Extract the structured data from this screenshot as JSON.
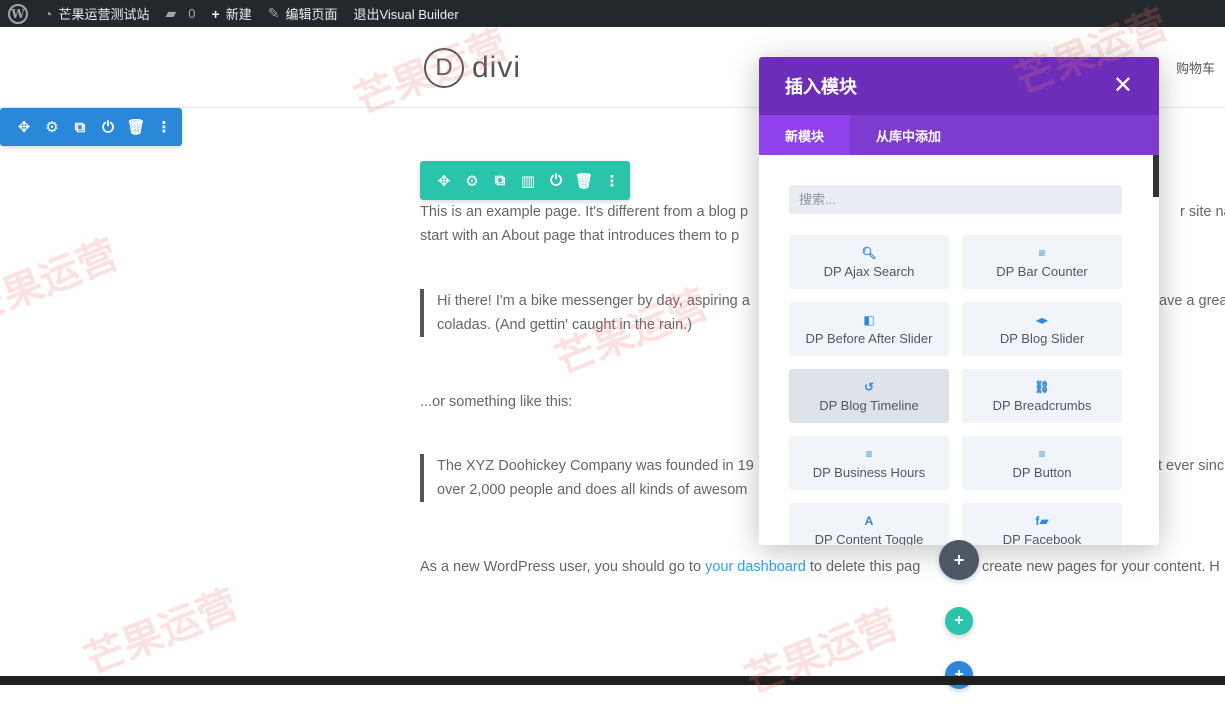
{
  "adminbar": {
    "site_name": "芒果运营测试站",
    "comments_count": "0",
    "new_label": "新建",
    "edit_label": "编辑页面",
    "exit_label": "退出Visual Builder"
  },
  "header": {
    "logo_letter": "D",
    "logo_word": "divi",
    "cart_label": "购物车"
  },
  "content": {
    "p1_line1": "This is an example page. It's different from a blog p",
    "p1_line1_right": "r site navi",
    "p1_line2": "start with an About page that introduces them to p",
    "q1_line1": "Hi there! I'm a bike messenger by day, aspiring a",
    "q1_line1_right": "ave a grea",
    "q1_line2": "coladas. (And gettin' caught in the rain.)",
    "p2": "...or something like this:",
    "q2_line1": "The XYZ Doohickey Company was founded in 19",
    "q2_line1_right": "t ever sinc",
    "q2_line2": "over 2,000 people and does all kinds of awesom",
    "p3_before": "As a new WordPress user, you should go to ",
    "p3_link": "your dashboard",
    "p3_after": " to delete this pag",
    "p3_right": "create new pages for your content. H"
  },
  "modal": {
    "title": "插入模块",
    "close": "✕",
    "tabs": [
      "新模块",
      "从库中添加"
    ],
    "search_placeholder": "搜索...",
    "modules": [
      {
        "label": "DP Ajax Search",
        "icon": "🔍︎"
      },
      {
        "label": "DP Bar Counter",
        "icon": "≡"
      },
      {
        "label": "DP Before After Slider",
        "icon": "◧"
      },
      {
        "label": "DP Blog Slider",
        "icon": "◂▸"
      },
      {
        "label": "DP Blog Timeline",
        "icon": "↺"
      },
      {
        "label": "DP Breadcrumbs",
        "icon": "⛓"
      },
      {
        "label": "DP Business Hours",
        "icon": "≡"
      },
      {
        "label": "DP Button",
        "icon": "≡"
      },
      {
        "label": "DP Content Toggle",
        "icon": "A"
      },
      {
        "label": "DP Facebook",
        "icon": "f▰"
      }
    ]
  },
  "fabs": {
    "plus": "+"
  },
  "watermark_text": "芒果运营",
  "colors": {
    "admin_bar": "#23282d",
    "row_toolbar": "#2b87da",
    "module_toolbar": "#29c4a9",
    "modal_header": "#6c2eb9",
    "modal_tabs": "#7e3bd0",
    "link": "#2ea3f2"
  }
}
